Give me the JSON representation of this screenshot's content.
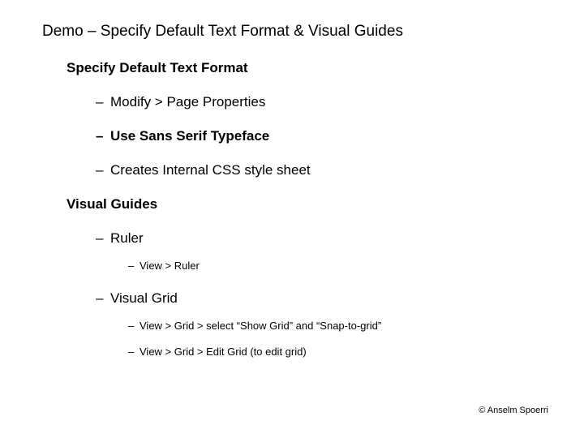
{
  "title": "Demo – Specify Default Text Format & Visual Guides",
  "section1": {
    "heading": "Specify Default Text Format",
    "items": [
      "Modify > Page Properties",
      "Use Sans Serif Typeface",
      "Creates Internal CSS style sheet"
    ]
  },
  "section2": {
    "heading": "Visual Guides",
    "items": [
      {
        "label": "Ruler",
        "sub": [
          "View > Ruler"
        ]
      },
      {
        "label": "Visual Grid",
        "sub": [
          "View > Grid > select “Show Grid” and “Snap-to-grid”",
          "View > Grid > Edit Grid  (to edit grid)"
        ]
      }
    ]
  },
  "footer": "© Anselm Spoerri",
  "bullet": "–"
}
